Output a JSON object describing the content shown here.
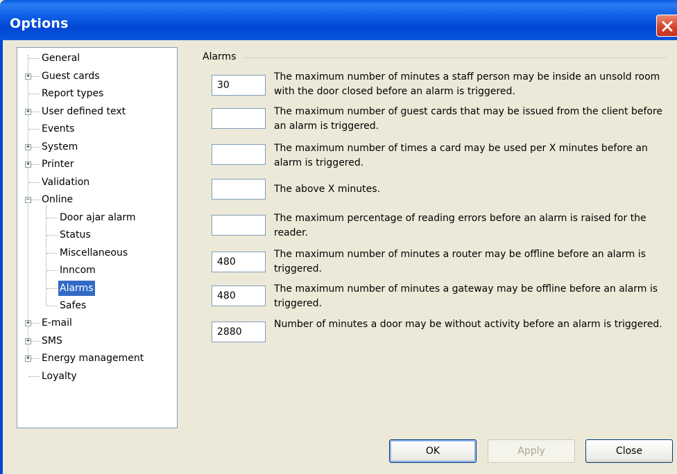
{
  "window": {
    "title": "Options"
  },
  "tree": {
    "items": [
      {
        "label": "General"
      },
      {
        "label": "Guest cards"
      },
      {
        "label": "Report types"
      },
      {
        "label": "User defined text"
      },
      {
        "label": "Events"
      },
      {
        "label": "System"
      },
      {
        "label": "Printer"
      },
      {
        "label": "Validation"
      },
      {
        "label": "Online"
      },
      {
        "label": "Door ajar alarm"
      },
      {
        "label": "Status"
      },
      {
        "label": "Miscellaneous"
      },
      {
        "label": "Inncom"
      },
      {
        "label": "Alarms"
      },
      {
        "label": "Safes"
      },
      {
        "label": "E-mail"
      },
      {
        "label": "SMS"
      },
      {
        "label": "Energy management"
      },
      {
        "label": "Loyalty"
      }
    ],
    "selected": "Alarms"
  },
  "alarms": {
    "group_label": "Alarms",
    "rows": [
      {
        "value": "30",
        "text": "The maximum number of minutes a staff person may be inside an unsold room with the door closed before an alarm is triggered."
      },
      {
        "value": "",
        "text": "The maximum number of guest cards that may be issued from the client before an alarm is triggered."
      },
      {
        "value": "",
        "text": "The maximum number of times a card may be used per X minutes before an alarm is triggered."
      },
      {
        "value": "",
        "text": "The above X minutes."
      },
      {
        "value": "",
        "text": "The maximum percentage of reading errors before an alarm is raised for the reader."
      },
      {
        "value": "480",
        "text": "The maximum number of minutes a router may be offline before an alarm is triggered."
      },
      {
        "value": "480",
        "text": "The maximum number of minutes a gateway may be offline before an alarm is triggered."
      },
      {
        "value": "2880",
        "text": "Number of minutes a door may be without activity before an alarm is triggered."
      }
    ]
  },
  "buttons": {
    "ok": "OK",
    "apply": "Apply",
    "close": "Close"
  },
  "colors": {
    "title_bar": "#0a5be0",
    "selection": "#316ac5",
    "dialog_bg": "#ece9d8"
  }
}
